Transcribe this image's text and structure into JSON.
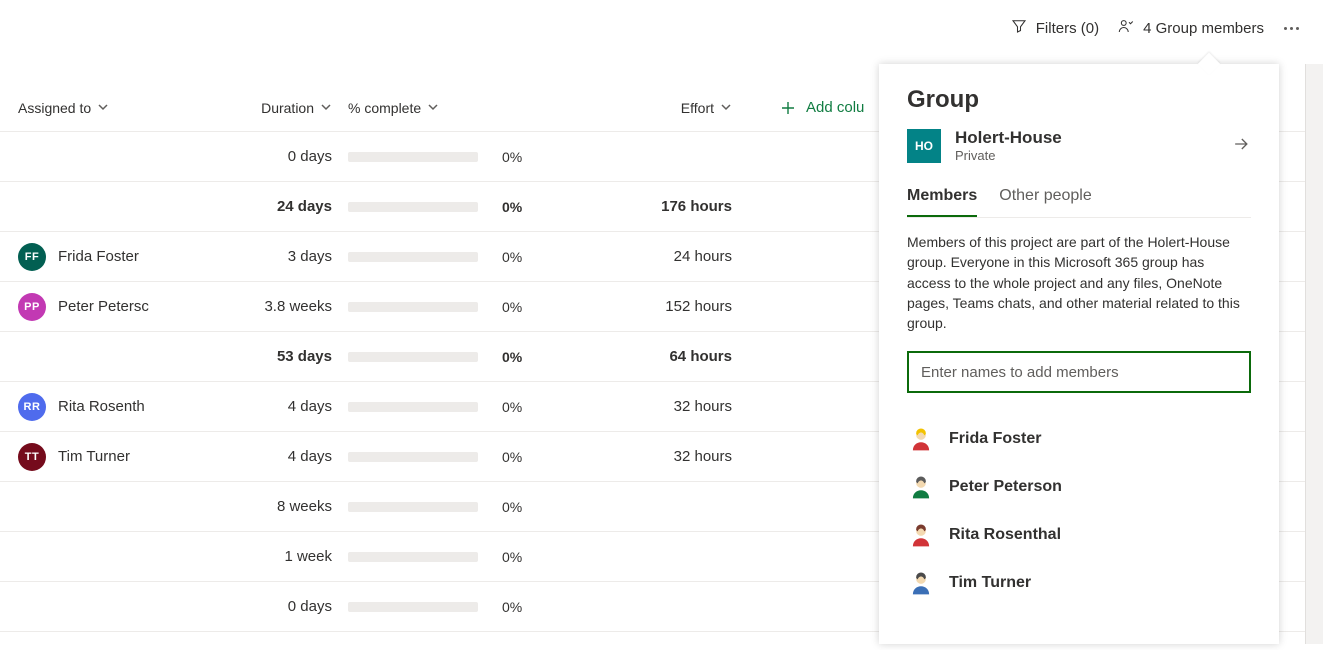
{
  "toolbar": {
    "filters_label": "Filters (0)",
    "members_label": "4 Group members"
  },
  "columns": {
    "assigned_to": "Assigned to",
    "duration": "Duration",
    "pct_complete": "% complete",
    "effort": "Effort",
    "add_column": "Add colu"
  },
  "rows": [
    {
      "assignee": null,
      "initials": "",
      "color": "",
      "duration": "0 days",
      "pct": "0%",
      "effort": "",
      "bold": false
    },
    {
      "assignee": null,
      "initials": "",
      "color": "",
      "duration": "24 days",
      "pct": "0%",
      "effort": "176 hours",
      "bold": true
    },
    {
      "assignee": "Frida Foster",
      "initials": "FF",
      "color": "#025f52",
      "duration": "3 days",
      "pct": "0%",
      "effort": "24 hours",
      "bold": false
    },
    {
      "assignee": "Peter Petersc",
      "initials": "PP",
      "color": "#c239b3",
      "duration": "3.8 weeks",
      "pct": "0%",
      "effort": "152 hours",
      "bold": false
    },
    {
      "assignee": null,
      "initials": "",
      "color": "",
      "duration": "53 days",
      "pct": "0%",
      "effort": "64 hours",
      "bold": true
    },
    {
      "assignee": "Rita Rosenth",
      "initials": "RR",
      "color": "#4f6bed",
      "duration": "4 days",
      "pct": "0%",
      "effort": "32 hours",
      "bold": false
    },
    {
      "assignee": "Tim Turner",
      "initials": "TT",
      "color": "#750b1c",
      "duration": "4 days",
      "pct": "0%",
      "effort": "32 hours",
      "bold": false
    },
    {
      "assignee": null,
      "initials": "",
      "color": "",
      "duration": "8 weeks",
      "pct": "0%",
      "effort": "",
      "bold": false
    },
    {
      "assignee": null,
      "initials": "",
      "color": "",
      "duration": "1 week",
      "pct": "0%",
      "effort": "",
      "bold": false
    },
    {
      "assignee": null,
      "initials": "",
      "color": "",
      "duration": "0 days",
      "pct": "0%",
      "effort": "",
      "bold": false
    }
  ],
  "panel": {
    "title": "Group",
    "group_tile": "HO",
    "group_name": "Holert-House",
    "group_privacy": "Private",
    "tabs": {
      "members": "Members",
      "other": "Other people"
    },
    "description": "Members of this project are part of the Holert-House group. Everyone in this Microsoft 365 group has access to the whole project and any files, OneNote pages, Teams chats, and other material related to this group.",
    "input_placeholder": "Enter names to add members",
    "members": [
      {
        "name": "Frida Foster",
        "hair": "#f2c200",
        "shirt": "#d13438"
      },
      {
        "name": "Peter Peterson",
        "hair": "#5b5b5b",
        "shirt": "#107c41"
      },
      {
        "name": "Rita Rosenthal",
        "hair": "#7a3b2e",
        "shirt": "#d13438"
      },
      {
        "name": "Tim Turner",
        "hair": "#4a4a4a",
        "shirt": "#3b6fb6"
      }
    ]
  }
}
